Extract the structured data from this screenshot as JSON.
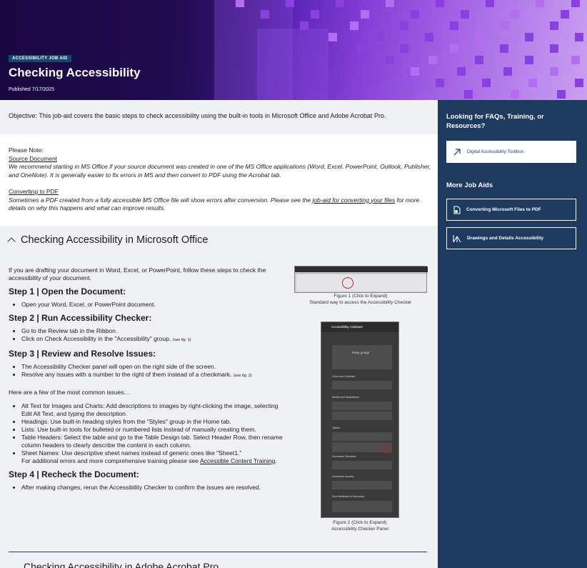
{
  "hero": {
    "tag": "ACCESSIBILITY JOB AID",
    "title": "Checking Accessibility",
    "published": "Published 7/17/2025"
  },
  "objective": "Objective: This job-aid covers the basic steps to check accessibility using the built-in tools in Microsoft Office and Adobe Acrobat Pro.",
  "note": {
    "heading": "Please Note:",
    "source_label": "Source Document",
    "source_text": "We recommend starting in MS Office if your source document was created in one of the MS Office applications (Word, Excel, PowerPoint, Outlook, Publisher, and OneNote). It is generally easier to fix errors in MS and then convert to PDF using the Acrobat tab.",
    "convert_label": "Converting to PDF",
    "convert_text_before": "Sometimes a PDF created from a fully accessible MS Office file will show errors after conversion. Please see the ",
    "convert_link": "job-aid for converting your files",
    "convert_text_after": " for more details on why this happens and what can improve results."
  },
  "section": {
    "title": "Checking Accessibility in Microsoft Office",
    "intro": "If you are drafting your document in Word, Excel, or PowerPoint, follow these steps to check the accessibility of your document.",
    "step1": {
      "title": "Step 1 | Open the Document:",
      "items": [
        "Open your Word, Excel, or PowerPoint document."
      ]
    },
    "step2": {
      "title": "Step 2 | Run Accessibility Checker:",
      "item1": "Go to the Review tab in the Ribbon.",
      "item2": "Click on Check Accessibility in the \"Accessibility\" group. ",
      "item2_ref": "(see fig. 1)"
    },
    "step3": {
      "title": "Step 3 | Review and Resolve Issues:",
      "item1": "The Accessibility Checker panel will open on the right side of the screen.",
      "item2": "Resolve any issues with a number to the right of them instead of a checkmark. ",
      "item2_ref": "(see fig. 2)"
    },
    "common_intro": "Here are a few of the most common issues...",
    "issues": [
      "Alt Text for Images and Charts: Add descriptions to images by right-clicking the image, selecting Edit Alt Text, and typing the description.",
      "Headings: Use built-in heading styles from the \"Styles\" group in the Home tab.",
      "Lists: Use built-in tools for bulleted or numbered lists instead of manually creating them.",
      "Table Headers: Select the table and go to the Table Design tab. Select Header Row, then rename column headers to clearly describe the content in each column."
    ],
    "sheet_names": "Sheet Names: Use descriptive sheet names instead of generic ones like \"Sheet1.\"",
    "additional": "For additional errors and more comprehensive training please see ",
    "additional_link": "Accessible Content Training",
    "additional_end": ".",
    "step4": {
      "title": "Step 4 | Recheck the Document:",
      "items": [
        "After making changes, rerun the Accessibility Checker to confirm the issues are resolved."
      ]
    },
    "fig1_caption_1": "Figure 1 (Click to Expand)",
    "fig1_caption_2": "Standard way to access the Accessibility Checker",
    "fig2_caption_1": "Figure 2 (Click to Expand)",
    "fig2_caption_2": "Accessibility Checker Panel",
    "fig2_panel": {
      "title": "Accessibility Assistant",
      "keep_going": "Keep going!",
      "groups": [
        "Color and Contrast",
        "Media and Illustrations",
        "Tables",
        "Document Structure",
        "Document Access",
        "Give feedback to Microsoft"
      ]
    },
    "next_title": "Checking Accessibility in Adobe Acrobat Pro"
  },
  "sidebar": {
    "faq_heading": "Looking for FAQs, Training, or Resources?",
    "toolbox_link": "Digital Accessibility Toolbox",
    "more_heading": "More Job Aids",
    "job_aids": [
      "Converting Microsoft Files to PDF",
      "Drawings and Details Accessibility"
    ]
  },
  "colors": {
    "sidebar_bg": "#1e3a5f",
    "section_bg": "#f0f1f5",
    "hero_accent": "#8b3fe0"
  }
}
